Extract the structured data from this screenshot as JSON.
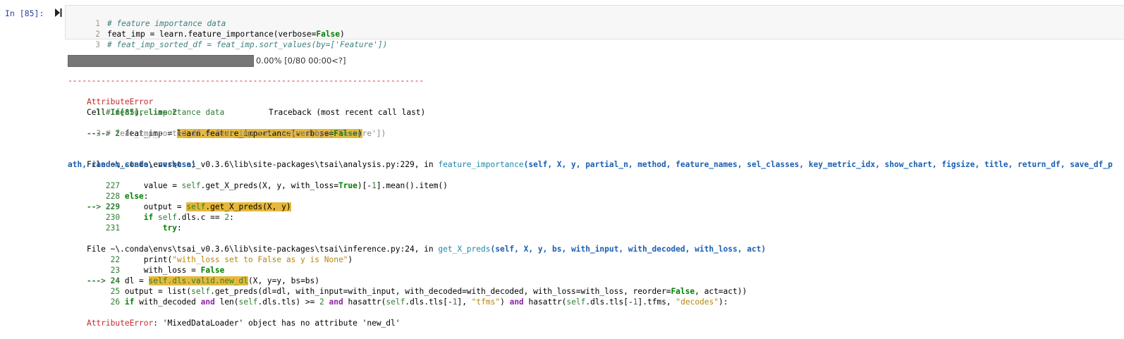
{
  "cell": {
    "prompt": "In [85]:",
    "code": {
      "l1_num": "1",
      "l1": "# feature importance data",
      "l2_num": "2",
      "l2_a": "feat_imp = learn.feature_importance(verbose=",
      "l2_b": "False",
      "l2_c": ")",
      "l3_num": "3",
      "l3": "# feat_imp_sorted_df = feat_imp.sort_values(by=['Feature'])"
    }
  },
  "progress": {
    "value": 0.0,
    "text": "0.00% [0/80 00:00<?]"
  },
  "traceback": {
    "separator": "---------------------------------------------------------------------------",
    "error_name": "AttributeError",
    "header_right": "Traceback (most recent call last)",
    "cell_ref_a": "Cell ",
    "cell_ref_b": "In[85], line 2",
    "t1_l1": "      1 # feature importance data",
    "t1_arrow": "----> 2 ",
    "t1_pre": "feat_imp = ",
    "t1_hl_a": "learn.feature_importance(verbose=",
    "t1_hl_b": "False",
    "t1_hl_c": ")",
    "t1_l3": "      3 # feat_imp_sorted_df = feat_imp.sort_values(by=['Feature'])",
    "f2_file": "File ~\\.conda\\envs\\tsai_v0.3.6\\lib\\site-packages\\tsai\\analysis.py:229",
    "f2_in": ", in ",
    "f2_func": "feature_importance",
    "f2_args1": "(self, X, y, partial_n, method, feature_names, sel_classes, key_metric_idx, show_chart, figsize, title, return_df, save_df_p",
    "f2_args2": "ath, random_state, verbose)",
    "f2_l227_num": "    227 ",
    "f2_l227_a": "    value = ",
    "f2_l227_b": "self",
    "f2_l227_c": ".get_X_preds(X, y, with_loss=",
    "f2_l227_d": "True",
    "f2_l227_e": ")[-",
    "f2_l227_f": "1",
    "f2_l227_g": "].mean().item()",
    "f2_l228_num": "    228 ",
    "f2_l228": "else",
    "f2_l229_arrow": "--> 229 ",
    "f2_l229_a": "    output = ",
    "f2_l229_hl_a": "self",
    "f2_l229_hl_b": ".get_X_preds(X, y)",
    "f2_l230_num": "    230 ",
    "f2_l230_a": "    ",
    "f2_l230_b": "if",
    "f2_l230_c": " ",
    "f2_l230_d": "self",
    "f2_l230_e": ".dls.c == ",
    "f2_l230_f": "2",
    "f2_l231_num": "    231 ",
    "f2_l231": "        try",
    "f3_file": "File ~\\.conda\\envs\\tsai_v0.3.6\\lib\\site-packages\\tsai\\inference.py:24",
    "f3_in": ", in ",
    "f3_func": "get_X_preds",
    "f3_args": "(self, X, y, bs, with_input, with_decoded, with_loss, act)",
    "f3_l22_num": "     22 ",
    "f3_l22_a": "    print(",
    "f3_l22_b": "\"with_loss set to False as y is None\"",
    "f3_l22_c": ")",
    "f3_l23_num": "     23 ",
    "f3_l23_a": "    with_loss = ",
    "f3_l23_b": "False",
    "f3_l24_arrow": "---> 24 ",
    "f3_l24_a": "dl = ",
    "f3_l24_hl": "self.dls.valid.new_dl",
    "f3_l24_b": "(X, y=y, bs=bs)",
    "f3_l25_num": "     25 ",
    "f3_l25_a": "output = list(",
    "f3_l25_b": "self",
    "f3_l25_c": ".get_preds(dl=dl, with_input=with_input, with_decoded=with_decoded, with_loss=with_loss, reorder=",
    "f3_l25_d": "False",
    "f3_l25_e": ", act=act))",
    "f3_l26_num": "     26 ",
    "f3_l26_a": "if",
    "f3_l26_b": " with_decoded ",
    "f3_l26_c": "and",
    "f3_l26_d": " len(",
    "f3_l26_e": "self",
    "f3_l26_f": ".dls.tls) >= ",
    "f3_l26_g": "2",
    "f3_l26_h": " ",
    "f3_l26_i": "and",
    "f3_l26_j": " hasattr(",
    "f3_l26_k": "self",
    "f3_l26_l": ".dls.tls[-",
    "f3_l26_m": "1",
    "f3_l26_n": "], ",
    "f3_l26_o": "\"tfms\"",
    "f3_l26_p": ") ",
    "f3_l26_q": "and",
    "f3_l26_r": " hasattr(",
    "f3_l26_s": "self",
    "f3_l26_t": ".dls.tls[-",
    "f3_l26_u": "1",
    "f3_l26_v": "].tfms, ",
    "f3_l26_w": "\"decodes\"",
    "f3_l26_x": "):",
    "final_name": "AttributeError",
    "final_msg": ": 'MixedDataLoader' object has no attribute 'new_dl'"
  },
  "colors": {
    "error": "#c62828",
    "highlight": "#e6b93b",
    "prompt": "#303f9f"
  }
}
